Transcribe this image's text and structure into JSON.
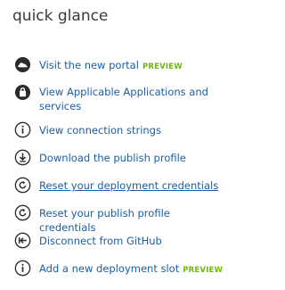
{
  "panel": {
    "title": "quick glance"
  },
  "items": [
    {
      "label": "Visit the new portal",
      "badge": "PREVIEW",
      "icon": "cloud-icon"
    },
    {
      "label": "View Applicable Applications and services",
      "icon": "shopping-bag-icon"
    },
    {
      "label": "View connection strings",
      "icon": "info-icon"
    },
    {
      "label": "Download the publish profile",
      "icon": "download-icon"
    },
    {
      "label": "Reset your deployment credentials",
      "icon": "refresh-icon"
    },
    {
      "label": "Reset your publish profile credentials",
      "icon": "refresh-icon"
    },
    {
      "label": "Disconnect from GitHub",
      "icon": "disconnect-icon"
    },
    {
      "label": "Add a new deployment slot",
      "badge": "PREVIEW",
      "icon": "info-icon"
    }
  ],
  "colors": {
    "link": "#1c5ea3",
    "badge": "#71b518",
    "icon": "#2b2b2b"
  }
}
